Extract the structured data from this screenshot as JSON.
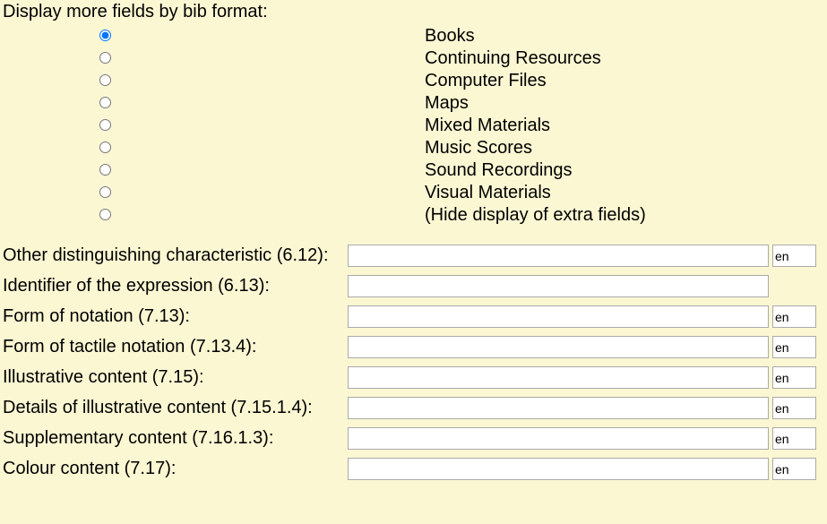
{
  "section_title": "Display more fields by bib format:",
  "radio_options": [
    {
      "label": "Books",
      "selected": true
    },
    {
      "label": "Continuing Resources",
      "selected": false
    },
    {
      "label": "Computer Files",
      "selected": false
    },
    {
      "label": "Maps",
      "selected": false
    },
    {
      "label": "Mixed Materials",
      "selected": false
    },
    {
      "label": "Music Scores",
      "selected": false
    },
    {
      "label": "Sound Recordings",
      "selected": false
    },
    {
      "label": "Visual Materials",
      "selected": false
    },
    {
      "label": "(Hide display of extra fields)",
      "selected": false
    }
  ],
  "fields": [
    {
      "label": "Other distinguishing characteristic (6.12):",
      "value": "",
      "lang": "en",
      "has_lang": true
    },
    {
      "label": "Identifier of the expression (6.13):",
      "value": "",
      "lang": "",
      "has_lang": false
    },
    {
      "label": "Form of notation (7.13):",
      "value": "",
      "lang": "en",
      "has_lang": true
    },
    {
      "label": "Form of tactile notation (7.13.4):",
      "value": "",
      "lang": "en",
      "has_lang": true
    },
    {
      "label": "Illustrative content (7.15):",
      "value": "",
      "lang": "en",
      "has_lang": true
    },
    {
      "label": "Details of illustrative content (7.15.1.4):",
      "value": "",
      "lang": "en",
      "has_lang": true
    },
    {
      "label": "Supplementary content (7.16.1.3):",
      "value": "",
      "lang": "en",
      "has_lang": true
    },
    {
      "label": "Colour content (7.17):",
      "value": "",
      "lang": "en",
      "has_lang": true
    }
  ]
}
